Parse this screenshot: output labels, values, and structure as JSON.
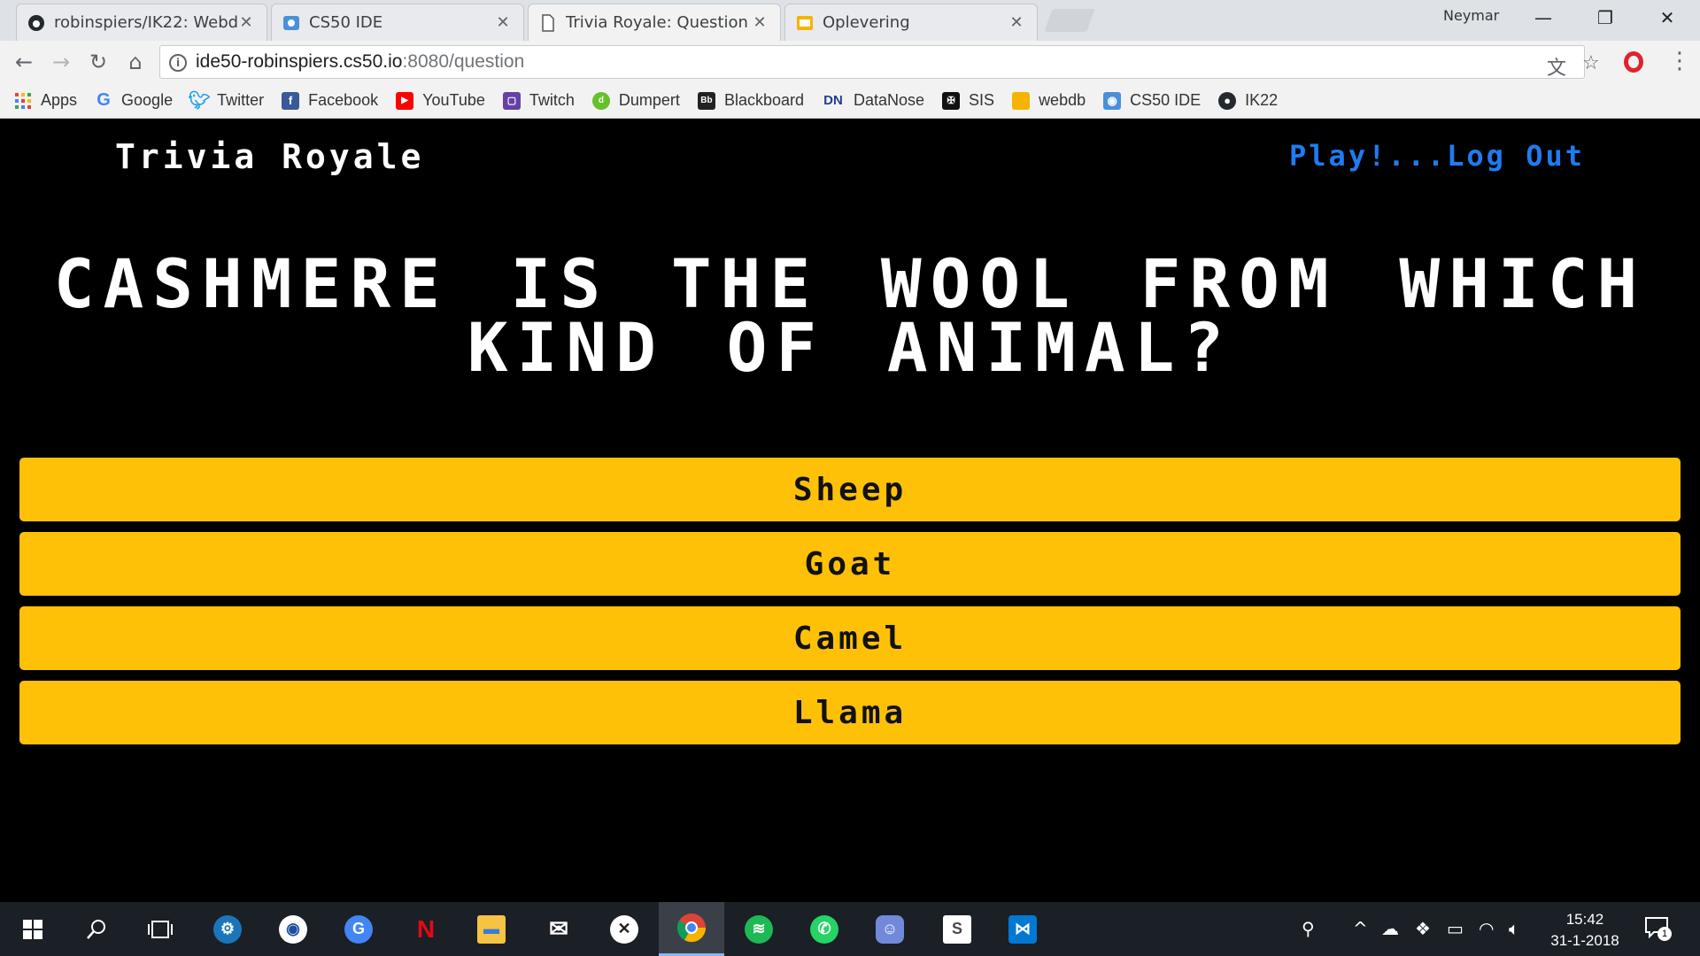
{
  "browser": {
    "tabs": [
      {
        "title": "robinspiers/IK22: Webdb",
        "favicon": "github-icon"
      },
      {
        "title": "CS50 IDE",
        "favicon": "cs50-ide-icon"
      },
      {
        "title": "Trivia Royale: Question",
        "favicon": "page-icon"
      },
      {
        "title": "Oplevering",
        "favicon": "slides-icon"
      }
    ],
    "profile_name": "Neymar",
    "url_host": "ide50-robinspiers.cs50.io",
    "url_rest": ":8080/question",
    "bookmarks": [
      {
        "label": "Apps",
        "icon": "apps-grid-icon"
      },
      {
        "label": "Google",
        "icon": "google-icon"
      },
      {
        "label": "Twitter",
        "icon": "twitter-icon"
      },
      {
        "label": "Facebook",
        "icon": "facebook-icon"
      },
      {
        "label": "YouTube",
        "icon": "youtube-icon"
      },
      {
        "label": "Twitch",
        "icon": "twitch-icon"
      },
      {
        "label": "Dumpert",
        "icon": "dumpert-icon"
      },
      {
        "label": "Blackboard",
        "icon": "blackboard-icon"
      },
      {
        "label": "DataNose",
        "icon": "datanose-icon"
      },
      {
        "label": "SIS",
        "icon": "sis-icon"
      },
      {
        "label": "webdb",
        "icon": "webdb-icon"
      },
      {
        "label": "CS50 IDE",
        "icon": "cs50-ide-icon"
      },
      {
        "label": "IK22",
        "icon": "github-icon"
      }
    ]
  },
  "app": {
    "brand": "Trivia Royale",
    "nav_play": "Play!",
    "nav_sep": "...",
    "nav_logout": "Log Out",
    "question": "Cashmere is the wool from which kind of animal?",
    "answers": [
      "Sheep",
      "Goat",
      "Camel",
      "Llama"
    ],
    "accent_color": "#ffc107",
    "link_color": "#1e7cf2"
  },
  "taskbar": {
    "time": "15:42",
    "date": "31-1-2018",
    "notification_count": "1"
  }
}
